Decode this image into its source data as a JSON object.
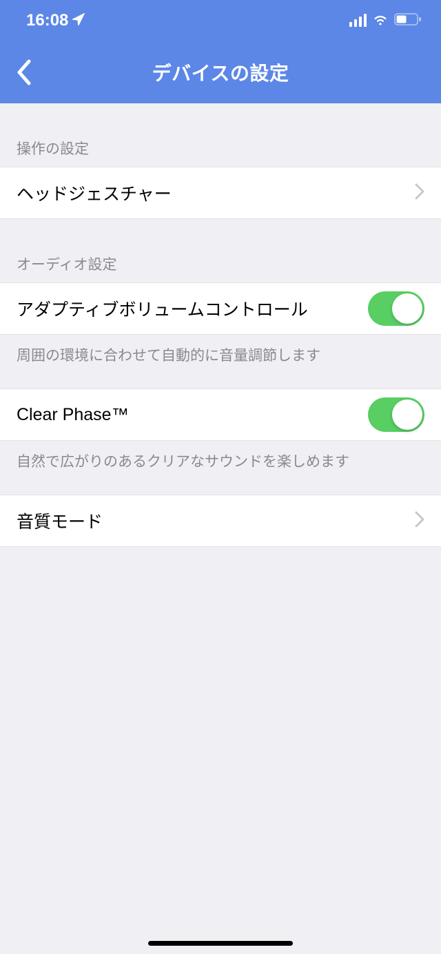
{
  "status": {
    "time": "16:08"
  },
  "nav": {
    "title": "デバイスの設定"
  },
  "sections": {
    "operation": {
      "header": "操作の設定",
      "head_gesture_label": "ヘッドジェスチャー"
    },
    "audio": {
      "header": "オーディオ設定",
      "adaptive_volume_label": "アダプティブボリュームコントロール",
      "adaptive_volume_on": true,
      "adaptive_volume_desc": "周囲の環境に合わせて自動的に音量調節します",
      "clear_phase_label": "Clear Phase™",
      "clear_phase_on": true,
      "clear_phase_desc": "自然で広がりのあるクリアなサウンドを楽しめます",
      "sound_quality_mode_label": "音質モード"
    }
  }
}
